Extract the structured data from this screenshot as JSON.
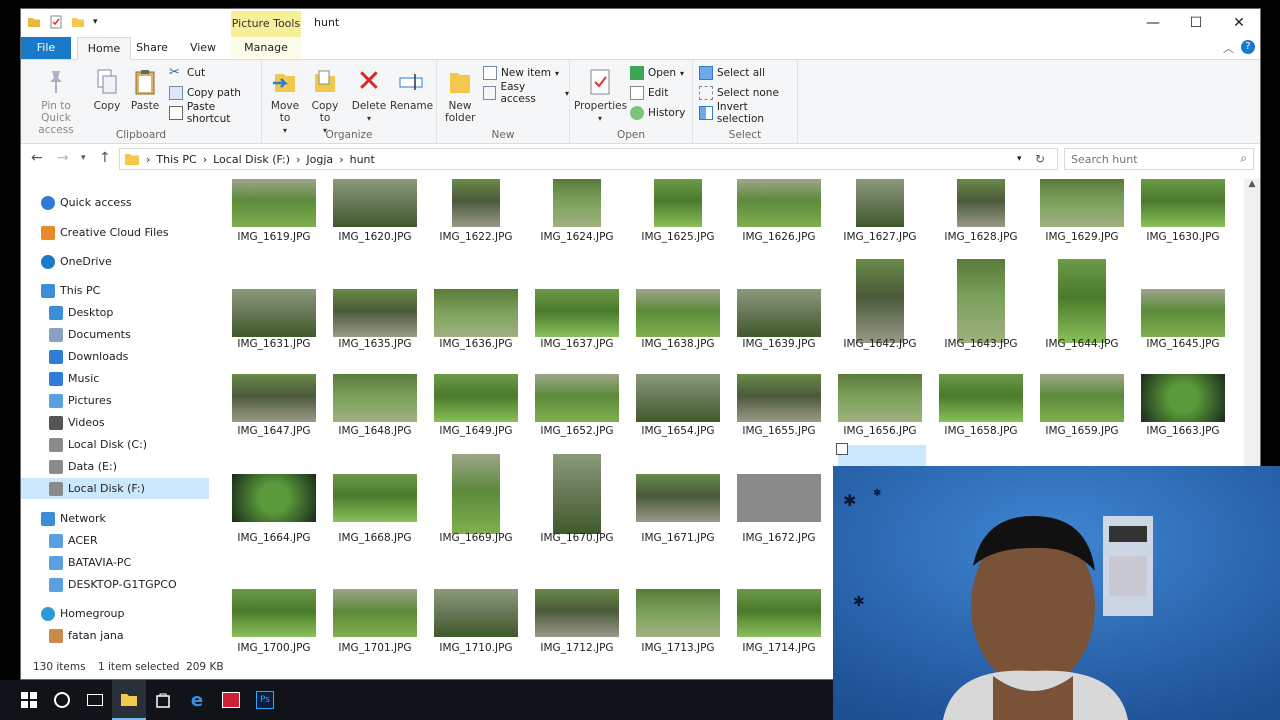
{
  "window": {
    "title": "hunt",
    "context_tab": "Picture Tools",
    "controls": {
      "minimize": "—",
      "maximize": "☐",
      "close": "✕"
    }
  },
  "tabs": [
    "File",
    "Home",
    "Share",
    "View",
    "Manage"
  ],
  "ribbon": {
    "clipboard": {
      "name": "Clipboard",
      "pin": "Pin to Quick access",
      "copy": "Copy",
      "paste": "Paste",
      "cut": "Cut",
      "copy_path": "Copy path",
      "paste_shortcut": "Paste shortcut"
    },
    "organize": {
      "name": "Organize",
      "move_to": "Move to",
      "copy_to": "Copy to",
      "delete": "Delete",
      "rename": "Rename"
    },
    "new": {
      "name": "New",
      "new_folder": "New folder",
      "new_item": "New item",
      "easy_access": "Easy access"
    },
    "open": {
      "name": "Open",
      "properties": "Properties",
      "open": "Open",
      "edit": "Edit",
      "history": "History"
    },
    "select": {
      "name": "Select",
      "select_all": "Select all",
      "select_none": "Select none",
      "invert": "Invert selection"
    }
  },
  "address": {
    "crumbs": [
      "This PC",
      "Local Disk (F:)",
      "Jogja",
      "hunt"
    ],
    "search_placeholder": "Search hunt"
  },
  "nav": [
    {
      "label": "Quick access",
      "icon": "star-icon"
    },
    {
      "label": "Creative Cloud Files",
      "icon": "cloud-folder-icon"
    },
    {
      "label": "OneDrive",
      "icon": "onedrive-icon"
    },
    {
      "label": "This PC",
      "icon": "computer-icon"
    },
    {
      "label": "Desktop",
      "icon": "desktop-icon"
    },
    {
      "label": "Documents",
      "icon": "documents-icon"
    },
    {
      "label": "Downloads",
      "icon": "downloads-icon"
    },
    {
      "label": "Music",
      "icon": "music-icon"
    },
    {
      "label": "Pictures",
      "icon": "pictures-icon"
    },
    {
      "label": "Videos",
      "icon": "videos-icon"
    },
    {
      "label": "Local Disk (C:)",
      "icon": "drive-icon"
    },
    {
      "label": "Data (E:)",
      "icon": "drive-icon"
    },
    {
      "label": "Local Disk (F:)",
      "icon": "drive-icon"
    },
    {
      "label": "Network",
      "icon": "network-icon"
    },
    {
      "label": "ACER",
      "icon": "pc-icon"
    },
    {
      "label": "BATAVIA-PC",
      "icon": "pc-icon"
    },
    {
      "label": "DESKTOP-G1TGPCO",
      "icon": "pc-icon"
    },
    {
      "label": "Homegroup",
      "icon": "homegroup-icon"
    },
    {
      "label": "fatan jana",
      "icon": "user-icon"
    }
  ],
  "files": [
    [
      "IMG_1619.JPG",
      "IMG_1620.JPG",
      "IMG_1622.JPG",
      "IMG_1624.JPG",
      "IMG_1625.JPG",
      "IMG_1626.JPG",
      "IMG_1627.JPG",
      "IMG_1628.JPG",
      "IMG_1629.JPG",
      "IMG_1630.JPG"
    ],
    [
      "IMG_1631.JPG",
      "IMG_1635.JPG",
      "IMG_1636.JPG",
      "IMG_1637.JPG",
      "IMG_1638.JPG",
      "IMG_1639.JPG",
      "IMG_1642.JPG",
      "IMG_1643.JPG",
      "IMG_1644.JPG",
      "IMG_1645.JPG"
    ],
    [
      "IMG_1647.JPG",
      "IMG_1648.JPG",
      "IMG_1649.JPG",
      "IMG_1652.JPG",
      "IMG_1654.JPG",
      "IMG_1655.JPG",
      "IMG_1656.JPG",
      "IMG_1658.JPG",
      "IMG_1659.JPG",
      "IMG_1663.JPG"
    ],
    [
      "IMG_1664.JPG",
      "IMG_1668.JPG",
      "IMG_1669.JPG",
      "IMG_1670.JPG",
      "IMG_1671.JPG",
      "IMG_1672.JPG"
    ],
    [
      "IMG_1700.JPG",
      "IMG_1701.JPG",
      "IMG_1710.JPG",
      "IMG_1712.JPG",
      "IMG_1713.JPG",
      "IMG_1714.JPG"
    ]
  ],
  "status": {
    "count": "130 items",
    "selected": "1 item selected  209 KB"
  },
  "colors": {
    "accent": "#1979ca",
    "selection": "#cce8ff",
    "context_tab": "#f7ee9a",
    "taskbar": "#101418"
  }
}
